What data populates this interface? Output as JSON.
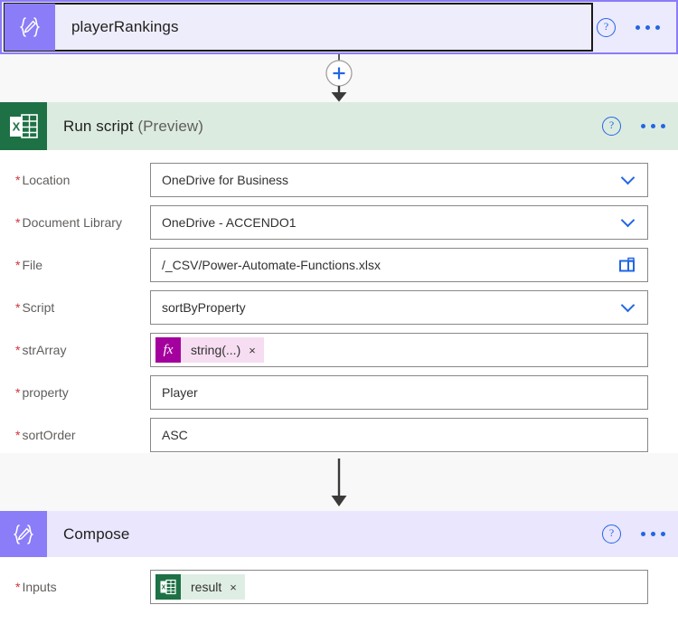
{
  "trigger": {
    "title": "playerRankings",
    "icon": "compose-braces-pencil-icon",
    "help_label": "?",
    "menu_label": "•••"
  },
  "connector_1": {
    "add_label": "+",
    "icon": "add-step-plus-icon"
  },
  "connector_2": {
    "icon": "flow-arrow-icon"
  },
  "run_script": {
    "title": "Run script",
    "title_suffix": "(Preview)",
    "icon": "excel-icon",
    "help_label": "?",
    "menu_label": "•••",
    "fields": [
      {
        "label": "Location",
        "required": "*",
        "value": "OneDrive for Business",
        "control": "dropdown",
        "name": "location"
      },
      {
        "label": "Document Library",
        "required": "*",
        "value": "OneDrive - ACCENDO1",
        "control": "dropdown",
        "name": "document-library"
      },
      {
        "label": "File",
        "required": "*",
        "value": "/_CSV/Power-Automate-Functions.xlsx",
        "control": "file-picker",
        "name": "file"
      },
      {
        "label": "Script",
        "required": "*",
        "value": "sortByProperty",
        "control": "dropdown",
        "name": "script"
      },
      {
        "label": "strArray",
        "required": "*",
        "value": "",
        "control": "token",
        "name": "strarray",
        "token": {
          "icon": "fx-icon",
          "icon_label": "fx",
          "text": "string(...)",
          "remove_label": "×"
        }
      },
      {
        "label": "property",
        "required": "*",
        "value": "Player",
        "control": "text",
        "name": "property"
      },
      {
        "label": "sortOrder",
        "required": "*",
        "value": "ASC",
        "control": "text",
        "name": "sortorder"
      }
    ]
  },
  "compose": {
    "title": "Compose",
    "icon": "compose-braces-pencil-icon",
    "help_label": "?",
    "menu_label": "•••",
    "fields": [
      {
        "label": "Inputs",
        "required": "*",
        "control": "token",
        "name": "inputs",
        "token": {
          "icon": "excel-icon",
          "text": "result",
          "remove_label": "×"
        }
      }
    ]
  },
  "colors": {
    "trigger_purple": "#8b7cf8",
    "trigger_bg": "#eceafd",
    "excel_green": "#1e7145",
    "run_script_header": "#dcebe0",
    "compose_header": "#e9e6fd",
    "accent_blue": "#2266e3",
    "required_red": "#d13438",
    "fx_magenta": "#a4009e",
    "token_pink": "#f6ddf2",
    "token_green": "#dfeee4"
  }
}
